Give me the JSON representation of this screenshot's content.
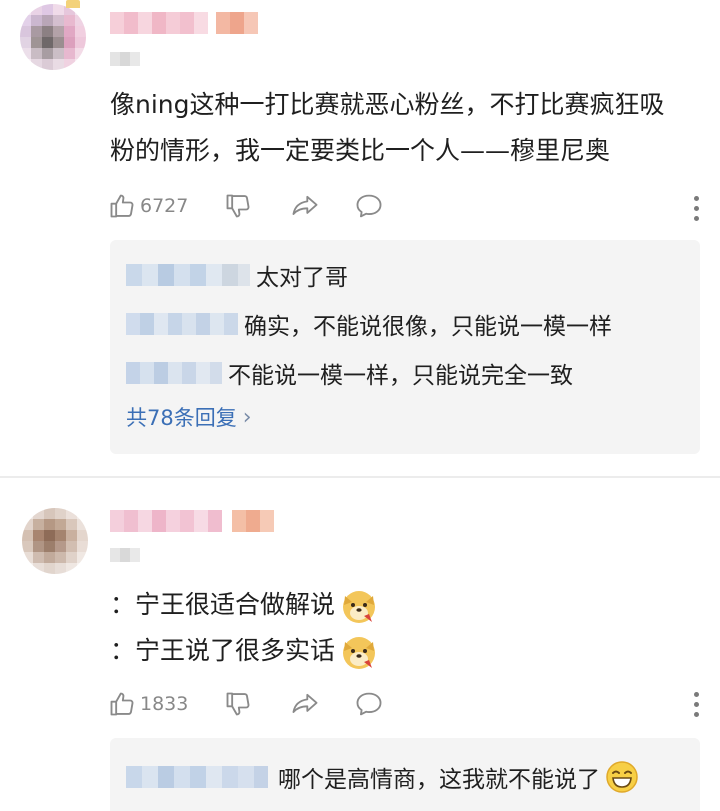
{
  "comments": [
    {
      "text_lines": [
        "像ning这种一打比赛就恶心粉丝，不打比赛疯狂吸",
        "粉的情形，我一定要类比一个人——穆里尼奥"
      ],
      "like_count": "6727",
      "replies": [
        {
          "text": "太对了哥"
        },
        {
          "text": "确实，不能说很像，只能说一模一样"
        },
        {
          "text": "不能说一模一样，只能说完全一致"
        }
      ],
      "reply_count_label": "共78条回复",
      "reply_count_chevron": "›"
    },
    {
      "text_lines": [
        "：宁王很适合做解说",
        "：宁王说了很多实话"
      ],
      "like_count": "1833",
      "replies": [
        {
          "text": "哪个是高情商，这我就不能说了"
        }
      ]
    }
  ],
  "icons": {
    "like": "thumbs-up-icon",
    "dislike": "thumbs-down-icon",
    "share": "share-icon",
    "comment": "comment-bubble-icon",
    "more": "more-vertical-icon",
    "doge_emoji": "doge-emoji-icon",
    "grin_emoji": "grin-emoji-icon"
  },
  "colors": {
    "reply_link": "#3b6fb6",
    "action_gray": "#888888",
    "reply_bg": "#f4f4f4"
  }
}
